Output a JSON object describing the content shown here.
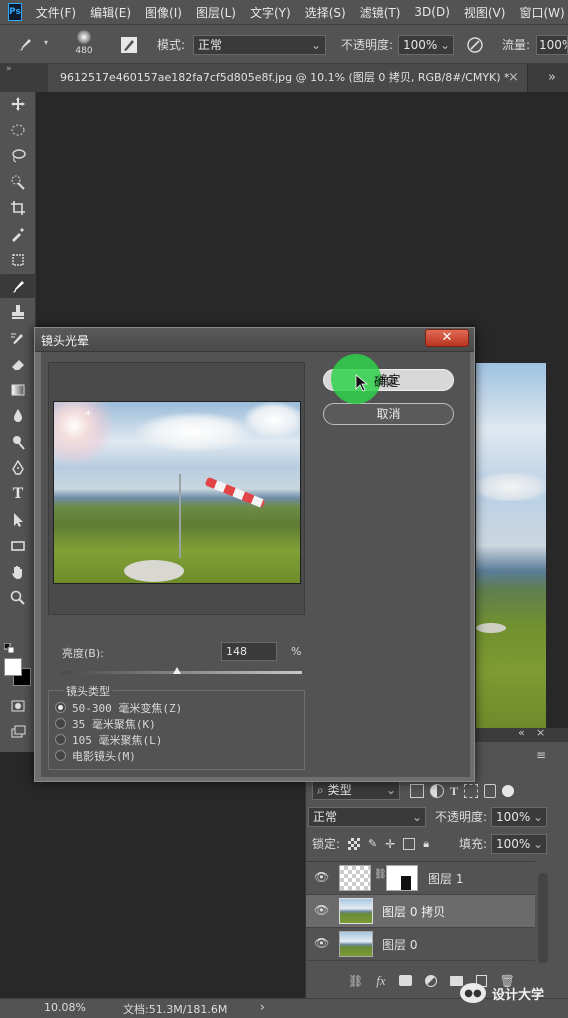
{
  "menubar": {
    "logo": "Ps",
    "items": [
      "文件(F)",
      "编辑(E)",
      "图像(I)",
      "图层(L)",
      "文字(Y)",
      "选择(S)",
      "滤镜(T)",
      "3D(D)",
      "视图(V)",
      "窗口(W)"
    ]
  },
  "options": {
    "brush_size": "480",
    "mode_label": "模式:",
    "mode_value": "正常",
    "opacity_label": "不透明度:",
    "opacity_value": "100%",
    "flow_label": "流量:",
    "flow_value": "100%"
  },
  "document_tab": {
    "title": "9612517e460157ae182fa7cf5d805e8f.jpg @ 10.1% (图层 0 拷贝, RGB/8#/CMYK) *",
    "close": "×"
  },
  "dialog": {
    "title": "镜头光晕",
    "ok_label": "确定",
    "cancel_label": "取消",
    "brightness_label": "亮度(B):",
    "brightness_value": "148",
    "brightness_unit": "%",
    "brightness_slider_fraction": 0.48,
    "lens_group_label": "镜头类型",
    "lens_options": [
      "50-300 毫米变焦(Z)",
      "35 毫米聚焦(K)",
      "105 毫米聚焦(L)",
      "电影镜头(M)"
    ],
    "selected_lens": "50-300 毫米变焦(Z)"
  },
  "layers_panel": {
    "filter_label": "类型",
    "blend_mode": "正常",
    "opacity_label": "不透明度:",
    "opacity_value": "100%",
    "lock_label": "锁定:",
    "fill_label": "填充:",
    "fill_value": "100%",
    "layers": [
      {
        "name": "图层 1",
        "selected": false,
        "has_mask": true
      },
      {
        "name": "图层 0 拷贝",
        "selected": true,
        "has_mask": false
      },
      {
        "name": "图层 0",
        "selected": false,
        "has_mask": false
      }
    ],
    "footer_icons": [
      "link-icon",
      "fx-icon",
      "mask-icon",
      "adjustment-icon",
      "folder-icon",
      "new-layer-icon",
      "trash-icon"
    ]
  },
  "statusbar": {
    "zoom": "10.08%",
    "doc_info": "文档:51.3M/181.6M",
    "arrow": "›"
  },
  "watermark": {
    "text": "设计大学"
  },
  "colors": {
    "accent_green": "#2fd14a",
    "ps_blue": "#31a8ff",
    "close_red": "#c8402f"
  }
}
